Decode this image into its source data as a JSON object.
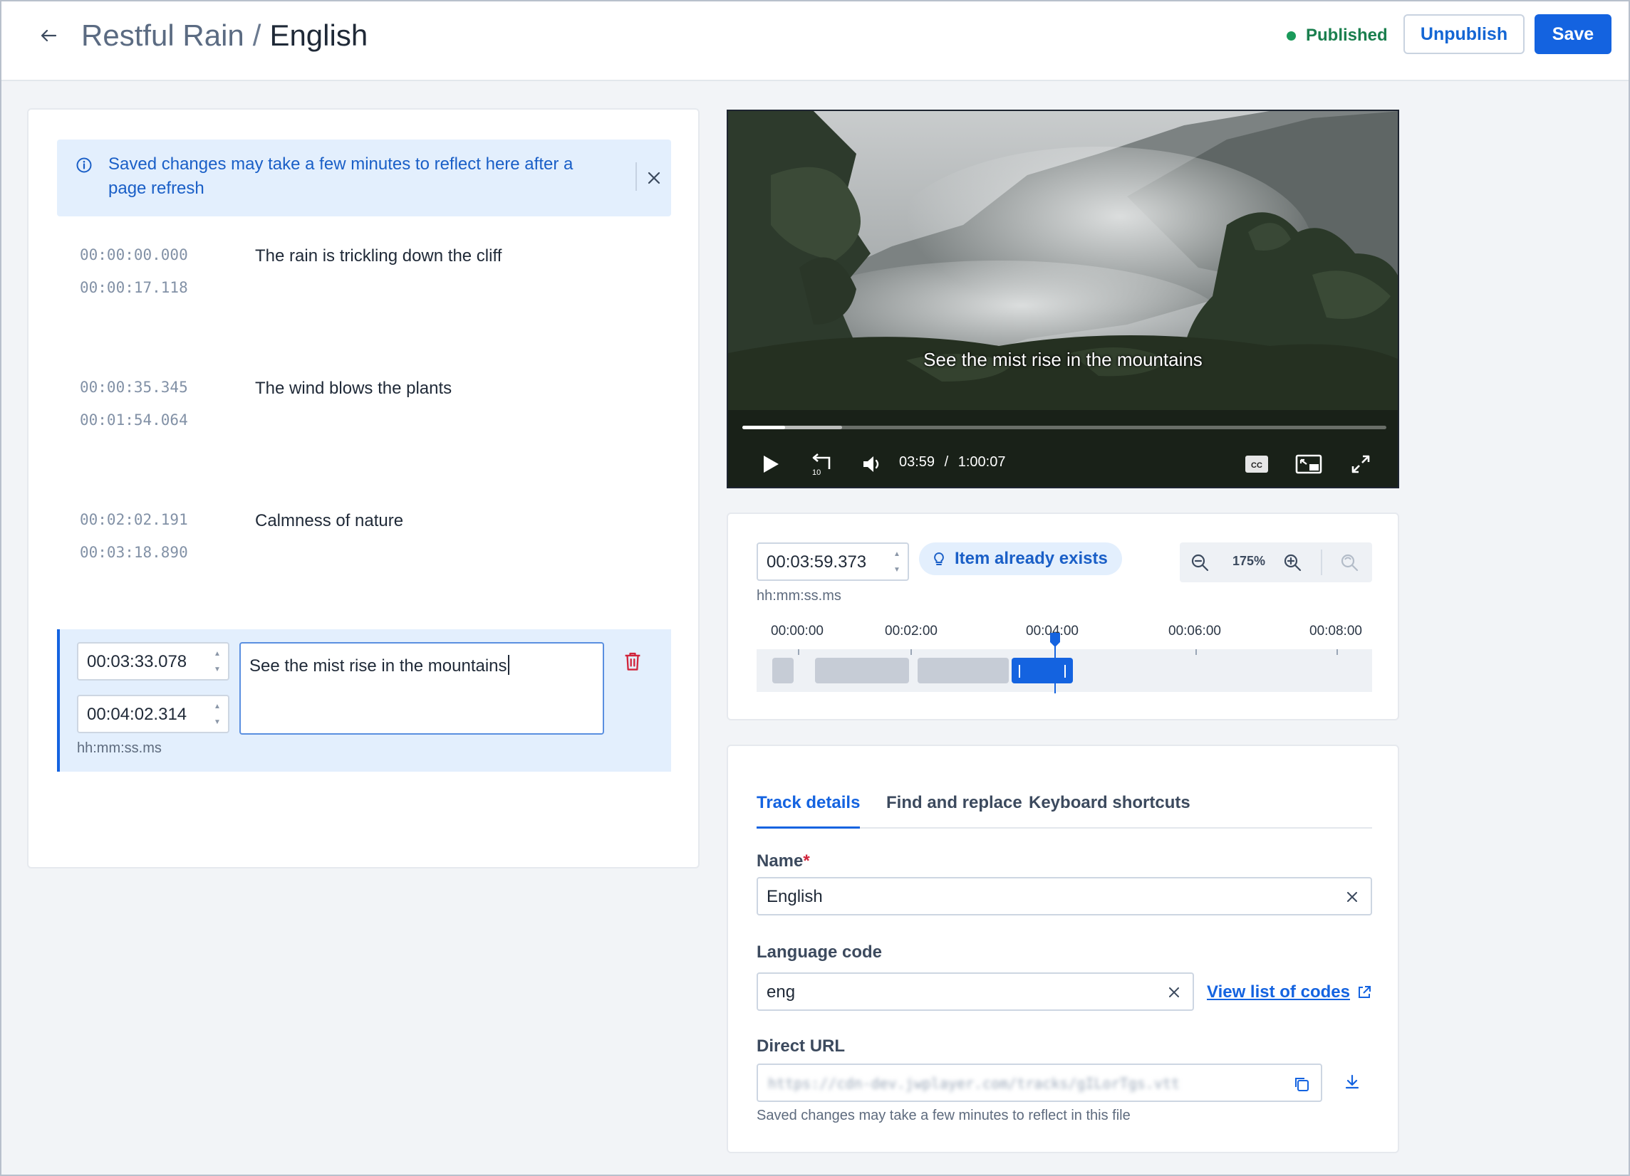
{
  "header": {
    "breadcrumb_parent": "Restful Rain",
    "separator": "/",
    "breadcrumb_current": "English",
    "status_text": "Published",
    "unpublish_label": "Unpublish",
    "save_label": "Save"
  },
  "banner": {
    "message_line1": "Saved changes may take a few minutes to reflect here after a",
    "message_line2": "page refresh"
  },
  "cues": [
    {
      "start": "00:00:00.000",
      "end": "00:00:17.118",
      "text": "The rain is trickling down the cliff"
    },
    {
      "start": "00:00:35.345",
      "end": "00:01:54.064",
      "text": "The wind blows the plants"
    },
    {
      "start": "00:02:02.191",
      "end": "00:03:18.890",
      "text": "Calmness of nature"
    }
  ],
  "active_cue": {
    "start": "00:03:33.078",
    "end": "00:04:02.314",
    "text": "See the mist rise in the mountains",
    "format_hint": "hh:mm:ss.ms"
  },
  "player": {
    "subtitle": "See the mist rise in the mountains",
    "current_time": "03:59",
    "time_separator": "/",
    "duration": "1:00:07",
    "progress_fraction": 0.066,
    "buffered_fraction": 0.155,
    "rewind_seconds": "10"
  },
  "timeline": {
    "current_time": "00:03:59.373",
    "format_hint": "hh:mm:ss.ms",
    "badge": "Item already exists",
    "zoom": "175%",
    "ticks": [
      "00:00:00",
      "00:02:00",
      "00:04:00",
      "00:06:00",
      "00:08:00"
    ]
  },
  "details": {
    "tabs": [
      "Track details",
      "Find and replace",
      "Keyboard shortcuts"
    ],
    "active_tab": "Track details",
    "name_label": "Name",
    "required_mark": "*",
    "name_value": "English",
    "language_label": "Language code",
    "language_value": "eng",
    "codes_link": "View list of codes",
    "url_label": "Direct URL",
    "url_value": "https://cdn-dev.jwplayer.com/tracks/gILorTgs.vtt",
    "url_note": "Saved changes may take a few minutes to reflect in this file"
  },
  "colors": {
    "primary": "#1463e0",
    "success": "#1a9a5a",
    "danger": "#d1243b",
    "banner_bg": "#e3effd"
  },
  "icons": {
    "back": "arrow-left-icon",
    "info": "info-circle-icon",
    "close": "close-icon",
    "trash": "trash-icon",
    "play": "play-icon",
    "rewind": "rewind-10-icon",
    "volume": "volume-icon",
    "captions": "captions-icon",
    "pip": "picture-in-picture-icon",
    "fullscreen": "fullscreen-icon",
    "bulb": "lightbulb-icon",
    "zoom_out": "zoom-out-icon",
    "zoom_in": "zoom-in-icon",
    "zoom_reset": "zoom-reset-icon",
    "external": "external-link-icon",
    "copy": "copy-icon",
    "download": "download-icon"
  }
}
